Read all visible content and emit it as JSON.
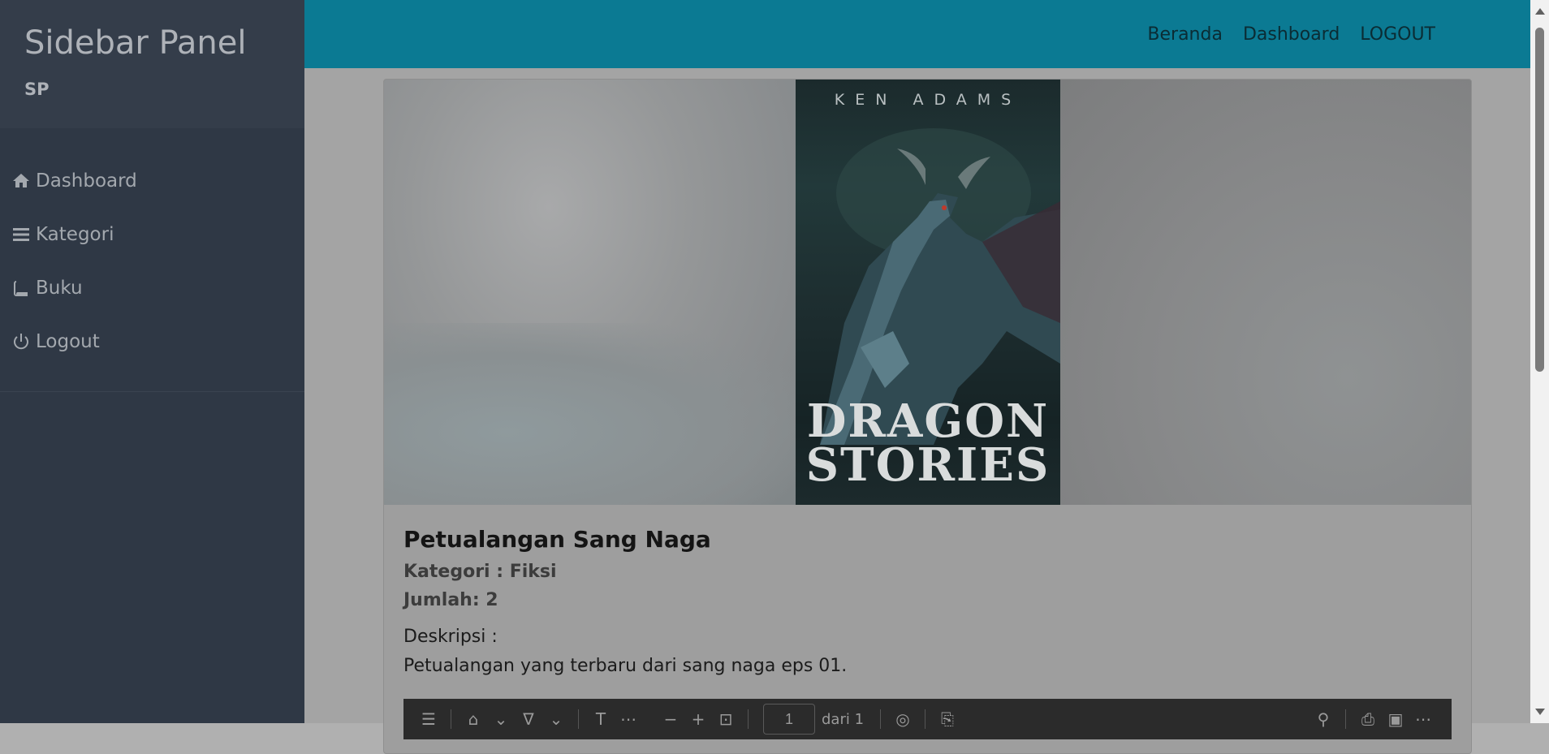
{
  "sidebar": {
    "title": "Sidebar Panel",
    "subtitle": "SP",
    "items": [
      {
        "label": "Dashboard",
        "icon": "home-icon"
      },
      {
        "label": "Kategori",
        "icon": "bars-icon"
      },
      {
        "label": "Buku",
        "icon": "book-icon"
      },
      {
        "label": "Logout",
        "icon": "power-icon"
      }
    ]
  },
  "topnav": {
    "items": [
      "Beranda",
      "Dashboard",
      "LOGOUT"
    ]
  },
  "book": {
    "cover_author": "KEN ADAMS",
    "cover_title_line1": "DRAGON",
    "cover_title_line2": "STORIES",
    "title": "Petualangan Sang Naga",
    "category": "Kategori : Fiksi",
    "quantity": "Jumlah: 2",
    "description_label": "Deskripsi :",
    "description": "Petualangan yang terbaru dari sang naga eps 01."
  },
  "pdf_toolbar": {
    "page_value": "1",
    "page_of": "dari 1"
  },
  "colors": {
    "sidebar_bg": "#2f3845",
    "topbar_bg": "#0b7a93",
    "main_bg": "#a4a4a4"
  }
}
